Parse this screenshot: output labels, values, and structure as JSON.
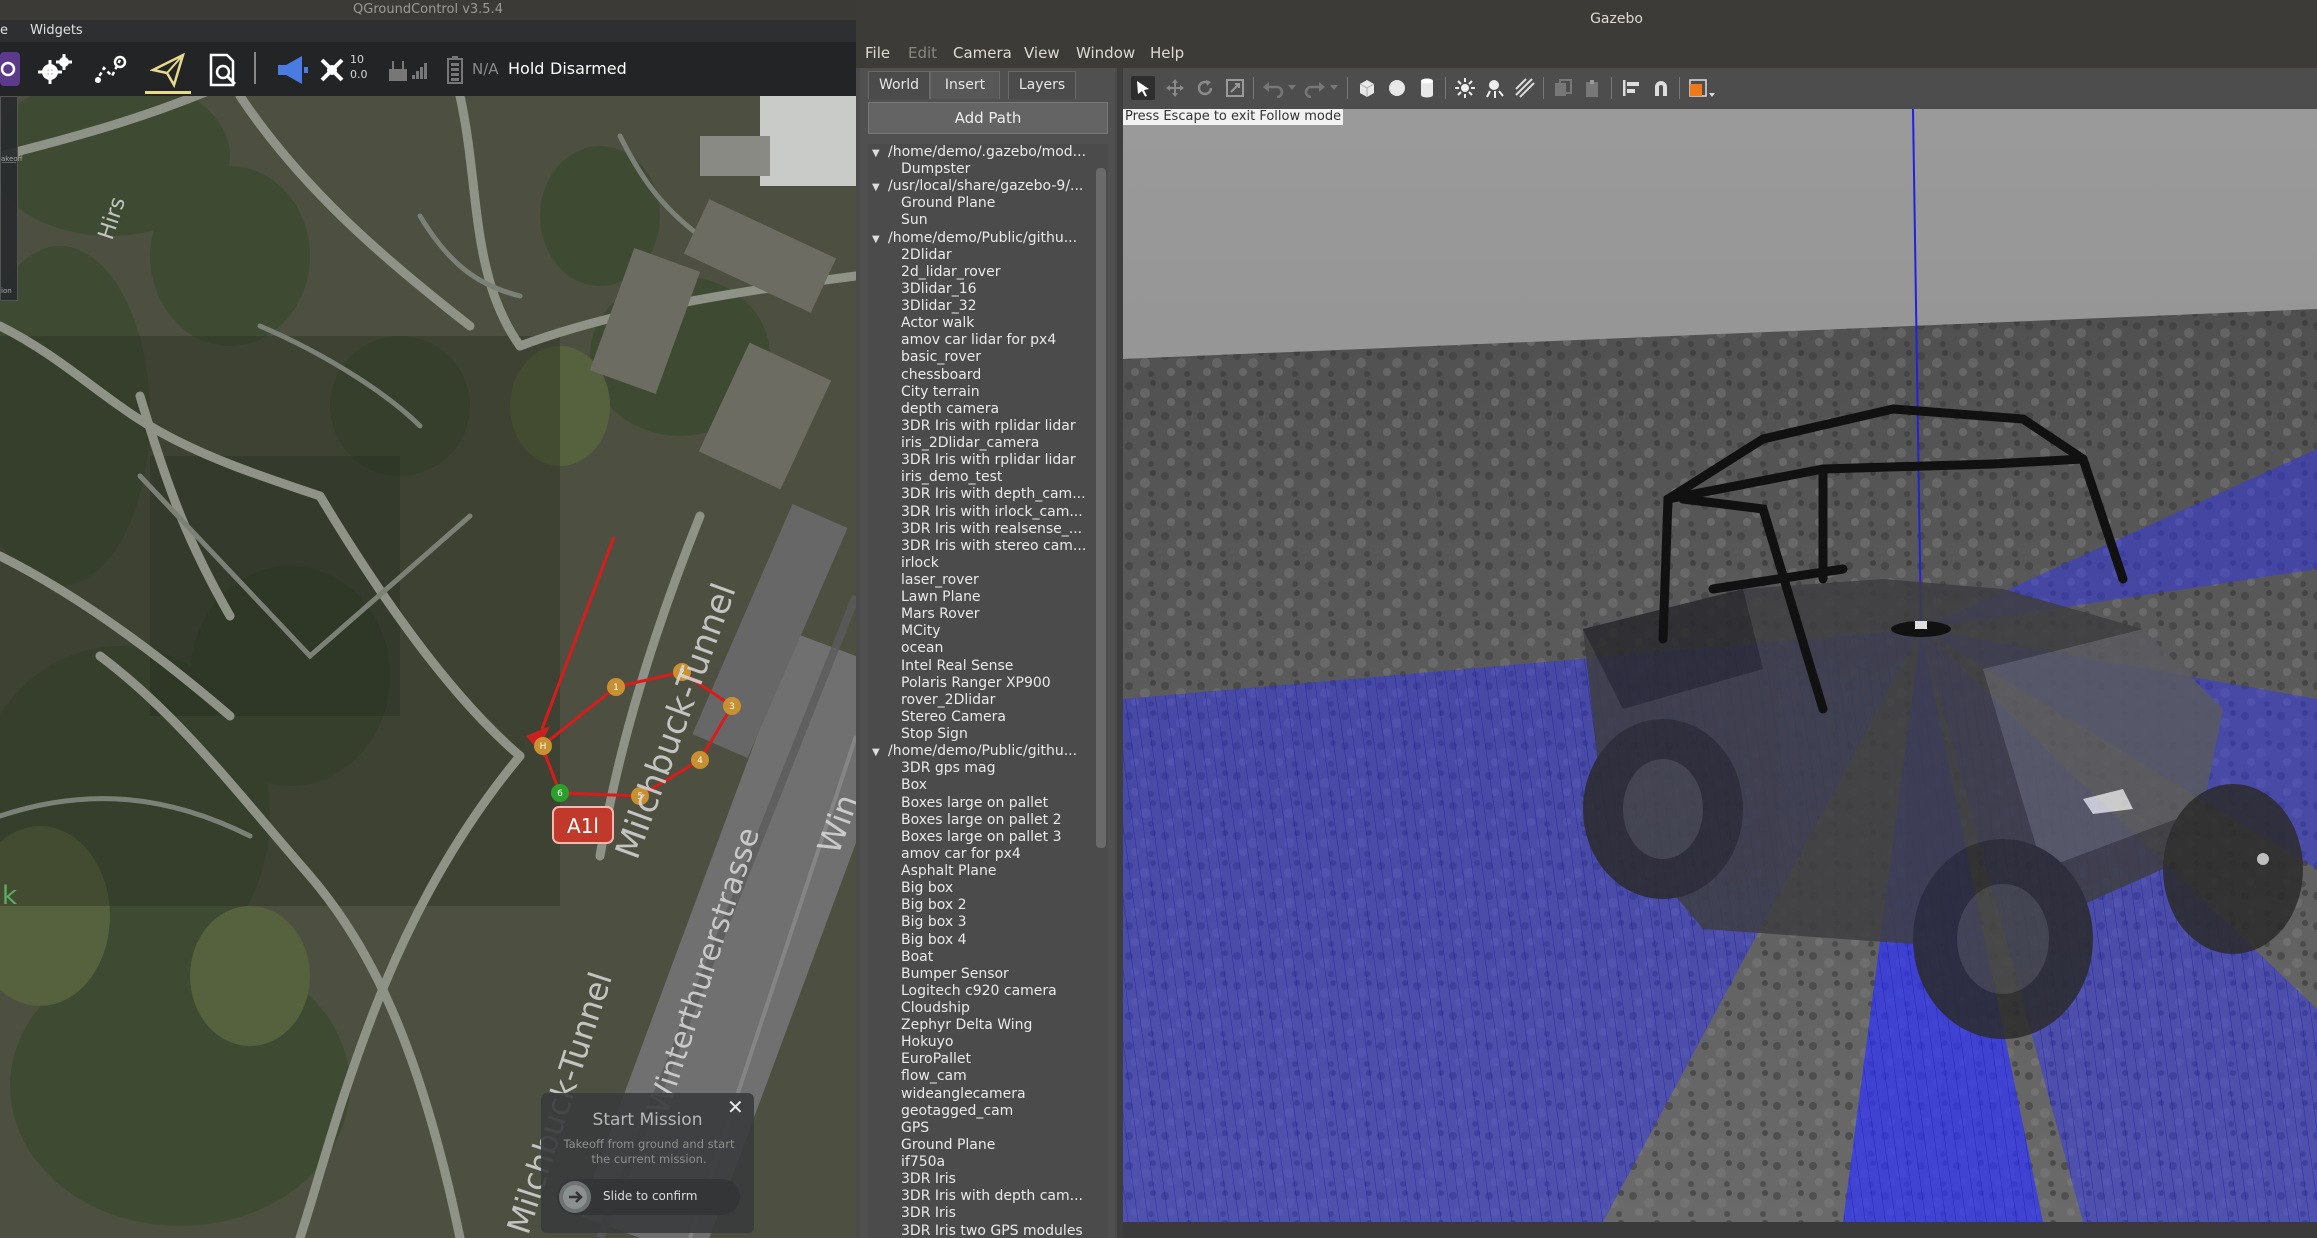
{
  "qgc": {
    "title": "QGroundControl v3.5.4",
    "menu": [
      "e",
      "Widgets"
    ],
    "toolbar": {
      "gps_count": "10",
      "gps_hdop": "0.0",
      "battery": "N/A",
      "flight_mode": "Hold",
      "arm_state": "Disarmed"
    },
    "map": {
      "waypoints": [
        "1",
        "2",
        "3",
        "4",
        "5",
        "6"
      ],
      "home_label": "H",
      "road_labels": [
        "Milchbuck-Tunnel",
        "Winterthurerstrasse",
        "Milchbuck-Tunnel",
        "Win",
        "Hirs",
        "k"
      ],
      "highway_shield": "A1l"
    },
    "mission": {
      "title": "Start Mission",
      "description": "Takeoff from ground and start the current mission.",
      "slider_label": "Slide to confirm"
    },
    "left_strip_labels": [
      "akeoff",
      "ion"
    ]
  },
  "gazebo": {
    "title": "Gazebo",
    "menu": [
      "File",
      "Edit",
      "Camera",
      "View",
      "Window",
      "Help"
    ],
    "tabs": [
      "World",
      "Insert",
      "Layers"
    ],
    "active_tab": "Insert",
    "add_path_label": "Add Path",
    "tree": [
      {
        "folder": "/home/demo/.gazebo/mod...",
        "items": [
          "Dumpster"
        ]
      },
      {
        "folder": "/usr/local/share/gazebo-9/...",
        "items": [
          "Ground Plane",
          "Sun"
        ]
      },
      {
        "folder": "/home/demo/Public/githu...",
        "items": [
          "2Dlidar",
          "2d_lidar_rover",
          "3Dlidar_16",
          "3Dlidar_32",
          "Actor walk",
          "amov car lidar for px4",
          "basic_rover",
          "chessboard",
          "City terrain",
          "depth camera",
          "3DR Iris with rplidar lidar",
          "iris_2Dlidar_camera",
          "3DR Iris with rplidar lidar",
          "iris_demo_test",
          "3DR Iris with depth_cam...",
          "3DR Iris with irlock_cam...",
          "3DR Iris with realsense_...",
          "3DR Iris with stereo cam...",
          "irlock",
          "laser_rover",
          "Lawn Plane",
          "Mars Rover",
          "MCity",
          "ocean",
          "Intel Real Sense",
          "Polaris Ranger XP900",
          "rover_2Dlidar",
          "Stereo Camera",
          "Stop Sign"
        ]
      },
      {
        "folder": "/home/demo/Public/githu...",
        "items": [
          "3DR gps mag",
          "Box",
          "Boxes large on pallet",
          "Boxes large on pallet 2",
          "Boxes large on pallet 3",
          "amov car for px4",
          "Asphalt Plane",
          "Big box",
          "Big box 2",
          "Big box 3",
          "Big box 4",
          "Boat",
          "Bumper Sensor",
          "Logitech c920 camera",
          "Cloudship",
          "Zephyr Delta Wing",
          "Hokuyo",
          "EuroPallet",
          "flow_cam",
          "wideanglecamera",
          "geotagged_cam",
          "GPS",
          "Ground Plane",
          "if750a",
          "3DR Iris",
          "3DR Iris with depth cam...",
          "3DR Iris",
          "3DR Iris two GPS modules"
        ]
      }
    ],
    "viewport_hint": "Press Escape to exit Follow mode",
    "colors": {
      "laser": "#2f33ff",
      "toolbar_accent": "#f07a1a"
    }
  }
}
